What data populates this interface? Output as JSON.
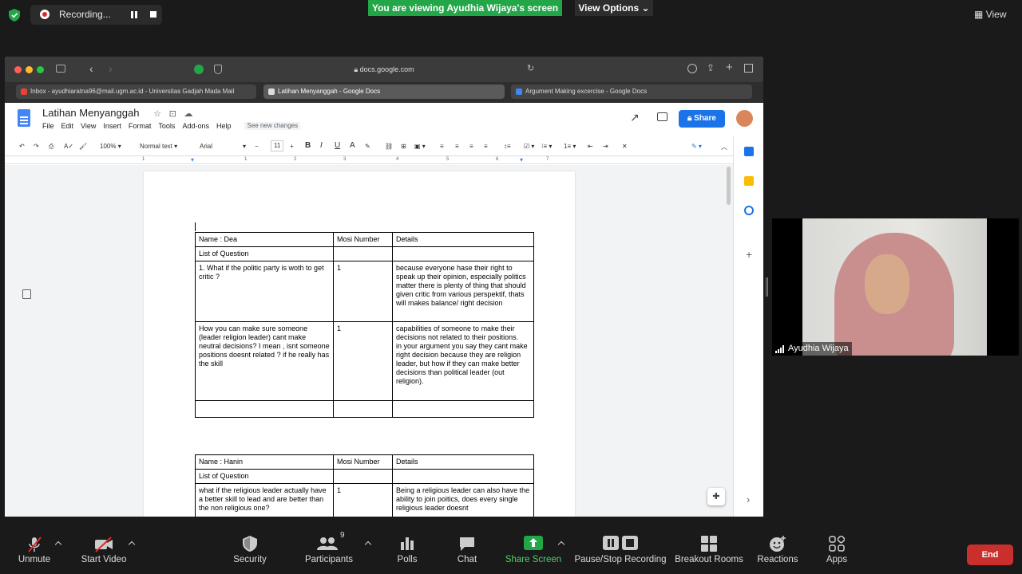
{
  "zoom_top": {
    "recording_label": "Recording...",
    "viewing_banner": "You are viewing Ayudhia Wijaya's screen",
    "view_options": "View Options",
    "view_button": "View"
  },
  "browser": {
    "url": "docs.google.com",
    "tabs": [
      {
        "label": "Inbox - ayudhiaratna96@mail.ugm.ac.id - Universitas Gadjah Mada Mail"
      },
      {
        "label": "Latihan Menyanggah - Google Docs"
      },
      {
        "label": "Argument Making excercise - Google Docs"
      }
    ]
  },
  "docs": {
    "title": "Latihan Menyanggah",
    "menu": [
      "File",
      "Edit",
      "View",
      "Insert",
      "Format",
      "Tools",
      "Add-ons",
      "Help"
    ],
    "see_changes": "See new changes",
    "share_label": "Share",
    "toolbar": {
      "zoom": "100%",
      "style": "Normal text",
      "font": "Arial",
      "size": "11"
    },
    "ruler_marks": [
      "1",
      "1",
      "2",
      "3",
      "4",
      "5",
      "6",
      "7"
    ],
    "table1": {
      "header": [
        "Name : Dea",
        "Mosi Number",
        "Details"
      ],
      "list_label": "List of Question",
      "rows": [
        {
          "question": "1. What if the politic party is woth to get critic ?",
          "mosi": "1",
          "details": "because everyone hase their right to speak up their opinion, especially politics matter there is plenty of thing that should given critic from various perspektif, thats will makes balance/ right decision"
        },
        {
          "question": "How you can  make sure someone (leader religion leader) cant make neutral decisions? I mean , isnt someone positions doesnt related ? if he really has the skill",
          "mosi": "1",
          "details": "capabilities of someone to make their decisions not related to their positions.\nin your argument you say they cant make right decision because they are religion leader, but how if they can make better decisions than political leader (out religion)."
        }
      ]
    },
    "table2": {
      "header": [
        "Name : Hanin",
        "Mosi Number",
        "Details"
      ],
      "list_label": "List of Question",
      "rows": [
        {
          "question": "what if the religious leader actually have a better skill to lead and are better than the non religious one?",
          "mosi": "1",
          "details": "Being a religious leader can also have the ability to join poitics, does every single religious leader doesnt"
        }
      ]
    }
  },
  "participant": {
    "name": "Ayudhia Wijaya"
  },
  "zoom_bottom": {
    "unmute": "Unmute",
    "start_video": "Start Video",
    "security": "Security",
    "participants": "Participants",
    "participants_count": "9",
    "polls": "Polls",
    "chat": "Chat",
    "share_screen": "Share Screen",
    "pause_stop": "Pause/Stop Recording",
    "breakout": "Breakout Rooms",
    "reactions": "Reactions",
    "apps": "Apps",
    "end": "End"
  },
  "colors": {
    "zoom_green": "#23a648",
    "docs_blue": "#1a73e8",
    "end_red": "#c9302c"
  }
}
